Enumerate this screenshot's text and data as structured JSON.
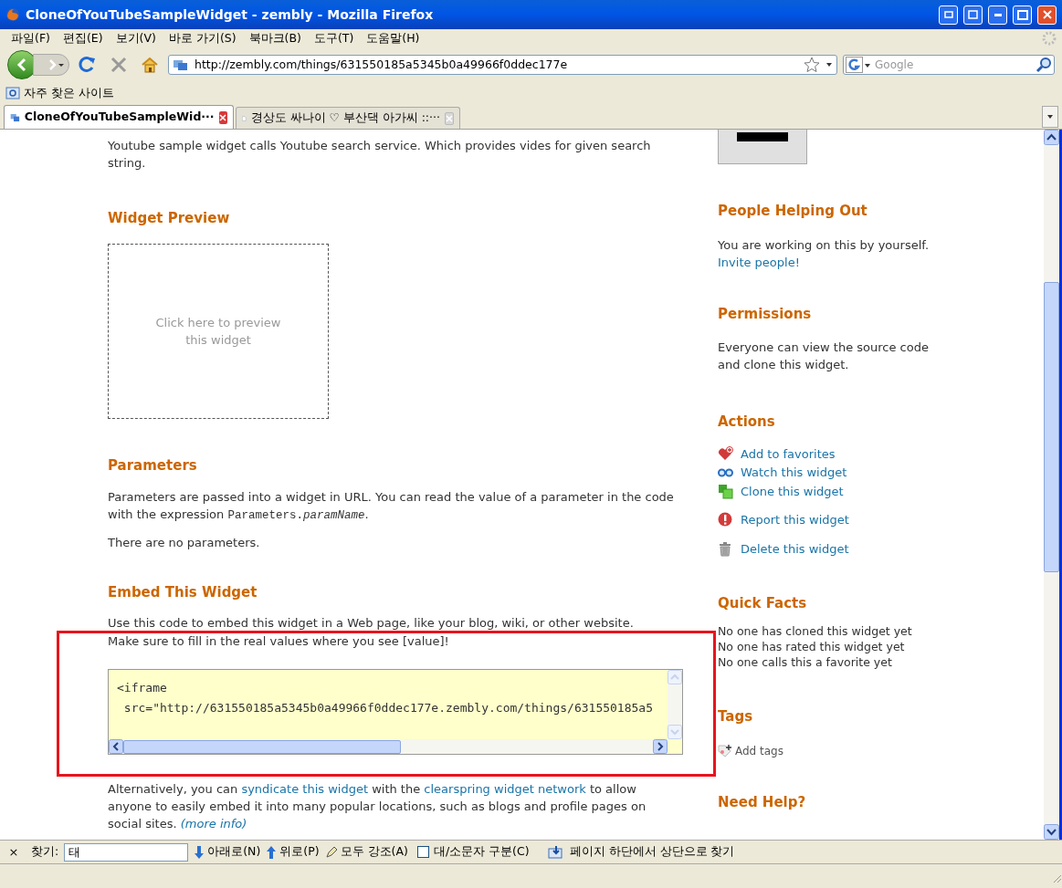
{
  "window": {
    "title": "CloneOfYouTubeSampleWidget - zembly - Mozilla Firefox"
  },
  "menu": [
    "파일(F)",
    "편집(E)",
    "보기(V)",
    "바로 가기(S)",
    "북마크(B)",
    "도구(T)",
    "도움말(H)"
  ],
  "address_bar": {
    "value": "http://zembly.com/things/631550185a5345b0a49966f0ddec177e"
  },
  "search_bar": {
    "placeholder": "Google"
  },
  "bookmarks": [
    "자주 찾은 사이트"
  ],
  "tabs": [
    {
      "label": "CloneOfYouTubeSampleWid···",
      "selected": true
    },
    {
      "label": "경상도 싸나이 ♡ 부산댁 아가씨 ::···",
      "selected": false
    }
  ],
  "left": {
    "intro": "Youtube sample widget calls Youtube search service. Which provides vides for given search string.",
    "sections": [
      {
        "kind": "preview",
        "heading": "Widget Preview",
        "preview_text": "Click here to preview this widget"
      },
      {
        "kind": "params",
        "heading": "Parameters",
        "paragraphs": [
          [
            {
              "kind": "text",
              "text": "Parameters are passed into a widget in URL. You can read the value of a parameter in the code with the expression "
            },
            {
              "kind": "code",
              "text": "Parameters.*paramName*"
            },
            {
              "kind": "text",
              "text": "."
            }
          ],
          [
            {
              "kind": "text",
              "text": "There are no parameters."
            }
          ]
        ]
      },
      {
        "kind": "embed",
        "heading": "Embed This Widget",
        "paragraphs": [
          [
            {
              "kind": "text",
              "text": "Use this code to embed this widget in a Web page, like your blog, wiki, or other website. Make sure to fill in the real values where you see [value]!"
            }
          ]
        ],
        "code_lines": [
          "<iframe",
          " src=\"http://631550185a5345b0a49966f0ddec177e.zembly.com/things/631550185a5"
        ],
        "after": [
          {
            "kind": "text",
            "text": "Alternatively, you can "
          },
          {
            "kind": "link",
            "text": "syndicate this widget"
          },
          {
            "kind": "text",
            "text": " with the "
          },
          {
            "kind": "link",
            "text": "clearspring widget network"
          },
          {
            "kind": "text",
            "text": " to allow anyone to easily embed it into many popular locations, such as blogs and profile pages on social sites. "
          },
          {
            "kind": "italic_link",
            "text": "(more info)"
          }
        ]
      }
    ]
  },
  "right": {
    "sections": [
      {
        "heading": "People Helping Out",
        "text": "You are working on this by yourself.",
        "link": "Invite people!"
      },
      {
        "heading": "Permissions",
        "text": "Everyone can view the source code and clone this widget."
      },
      {
        "heading": "Actions",
        "action_groups": [
          [
            {
              "kind": "favorite",
              "label": "Add to favorites"
            },
            {
              "kind": "watch",
              "label": "Watch this widget"
            },
            {
              "kind": "clone",
              "label": "Clone this widget"
            }
          ],
          [
            {
              "kind": "report",
              "label": "Report this widget"
            }
          ],
          [
            {
              "kind": "delete",
              "label": "Delete this widget"
            }
          ]
        ]
      },
      {
        "heading": "Quick Facts",
        "facts": [
          "No one has cloned this widget yet",
          "No one has rated this widget yet",
          "No one calls this a favorite yet"
        ]
      },
      {
        "heading": "Tags",
        "tag_action": "Add tags"
      },
      {
        "heading": "Need Help?"
      }
    ]
  },
  "find_bar": {
    "close": "×",
    "label": "찾기:",
    "value": "태",
    "next": "아래로(N)",
    "previous": "위로(P)",
    "highlight": "모두 강조(A)",
    "match_case": {
      "label": "대/소문자 구분(C)",
      "checked": false
    },
    "wrapped": "페이지 하단에서 상단으로 찾기"
  }
}
